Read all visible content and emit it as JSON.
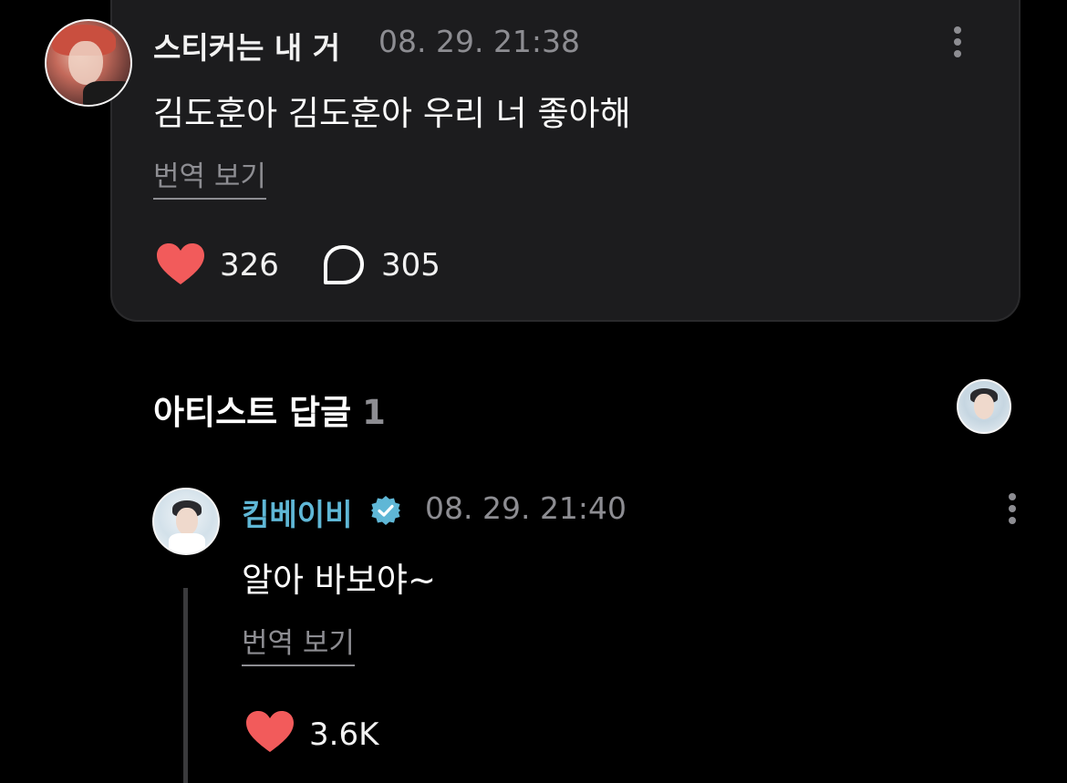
{
  "comment": {
    "author": "스티커는 내 거",
    "timestamp": "08. 29. 21:38",
    "text": "김도훈아 김도훈아 우리 너 좋아해",
    "translate_label": "번역 보기",
    "likes": "326",
    "replies": "305"
  },
  "artist_section": {
    "title": "아티스트 답글",
    "count": "1"
  },
  "reply": {
    "author": "킴베이비",
    "timestamp": "08. 29. 21:40",
    "text": "알아 바보야~",
    "translate_label": "번역 보기",
    "likes": "3.6K"
  },
  "icons": {
    "like": "heart-icon",
    "reply": "speech-bubble-icon",
    "more": "more-vertical-icon",
    "verified": "verified-badge-icon"
  },
  "colors": {
    "background": "#000000",
    "card": "#1c1c1e",
    "heart": "#f25b5b",
    "muted_text": "#8d8d92",
    "artist_name": "#5fb7d6",
    "verified_badge": "#5fb7d6"
  }
}
